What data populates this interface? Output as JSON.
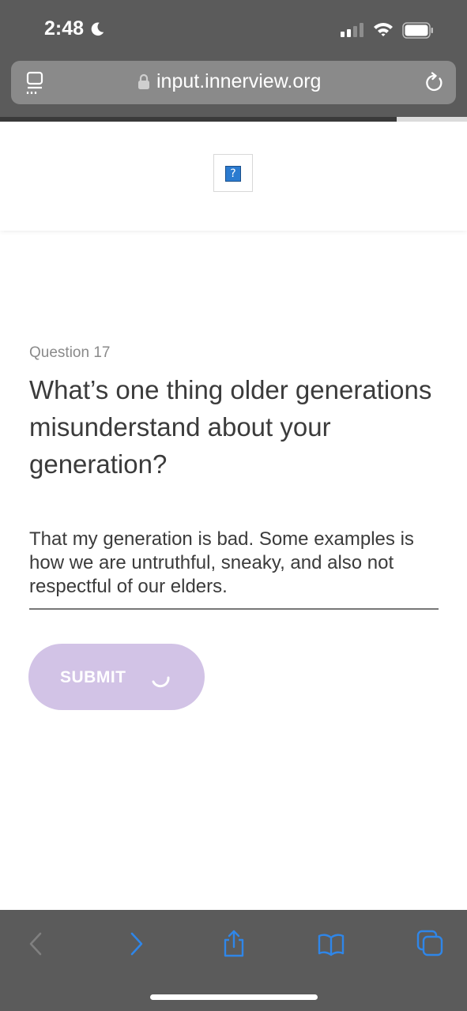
{
  "status_bar": {
    "time": "2:48"
  },
  "browser": {
    "url": "input.innerview.org",
    "load_progress": 0.85
  },
  "page": {
    "question_label": "Question 17",
    "question_text": "What’s one thing older generations misunderstand about your generation?",
    "answer_text": "That my generation is bad. Some examples is how we are untruthful, sneaky, and also not respectful of our elders.",
    "submit_label": "SUBMIT",
    "broken_image_glyph": "?"
  },
  "colors": {
    "chrome": "#5b5b5b",
    "submit_bg": "#d2c3e6",
    "toolbar_active": "#2f86e8"
  },
  "toolbar_icons": [
    "back-icon",
    "forward-icon",
    "share-icon",
    "bookmarks-icon",
    "tabs-icon"
  ]
}
